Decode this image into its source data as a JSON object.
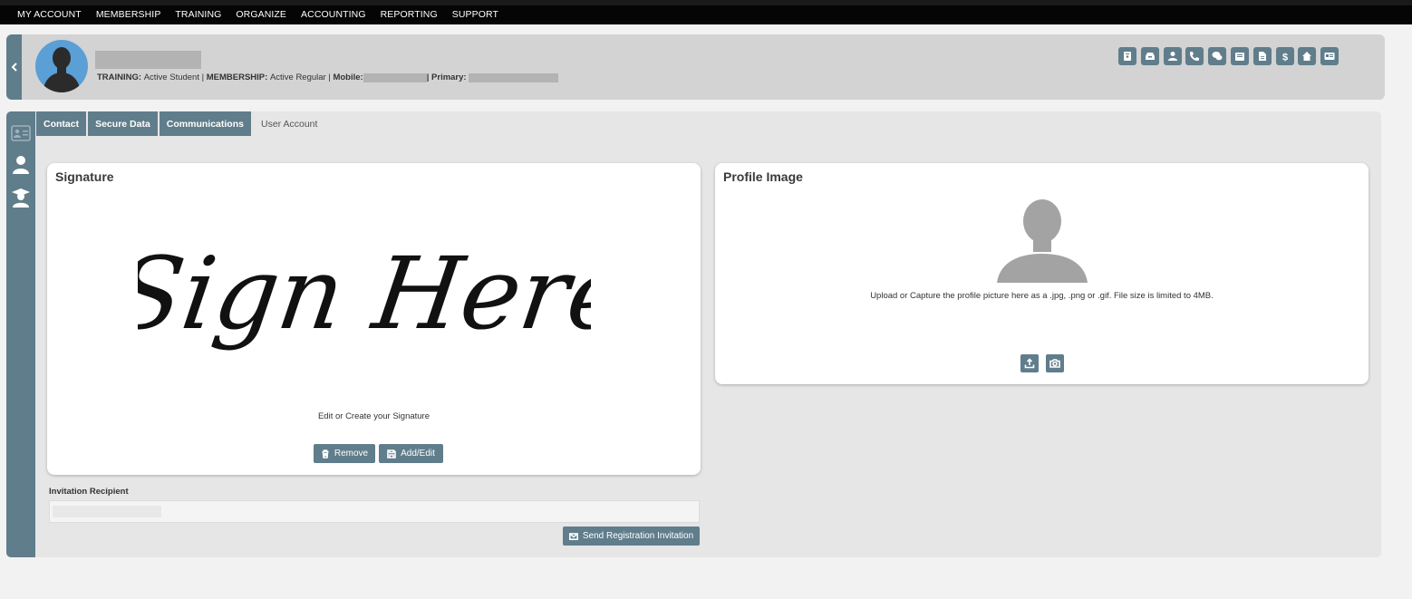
{
  "top_nav": {
    "items": [
      "MY ACCOUNT",
      "MEMBERSHIP",
      "TRAINING",
      "ORGANIZE",
      "ACCOUNTING",
      "REPORTING",
      "SUPPORT"
    ]
  },
  "header": {
    "collapse_icon": "chevron-left-icon",
    "avatar_icon": "person-silhouette-icon",
    "training_label": "TRAINING:",
    "training_value": "Active Student",
    "membership_label": "MEMBERSHIP:",
    "membership_value": "Active Regular",
    "mobile_label": "Mobile:",
    "primary_label": "Primary:",
    "separator": "|",
    "quick_icons": [
      "id-badge-icon",
      "inbox-icon",
      "person-icon",
      "phone-icon",
      "chat-icon",
      "mail-tray-icon",
      "document-icon",
      "dollar-icon",
      "house-icon",
      "id-card-icon"
    ]
  },
  "side_rail": {
    "icons": [
      "contact-card-icon",
      "user-icon",
      "student-icon"
    ]
  },
  "tabs": [
    {
      "label": "Contact",
      "active": true
    },
    {
      "label": "Secure Data",
      "active": true
    },
    {
      "label": "Communications",
      "active": true
    },
    {
      "label": "User Account",
      "active": false
    }
  ],
  "signature": {
    "title": "Signature",
    "image_text": "Sign Here",
    "caption": "Edit or Create your Signature",
    "remove_label": "Remove",
    "add_edit_label": "Add/Edit"
  },
  "profile_image": {
    "title": "Profile Image",
    "caption": "Upload or Capture the profile picture here as a .jpg, .png or .gif. File size is limited to 4MB.",
    "upload_icon": "upload-icon",
    "camera_icon": "camera-icon"
  },
  "invitation": {
    "label": "Invitation Recipient",
    "send_label": "Send Registration Invitation"
  },
  "colors": {
    "accent": "#607d8b",
    "nav_bg": "#050505",
    "header_bg": "#d3d3d3",
    "panel_bg": "#e6e6e6",
    "avatar_bg": "#5a9fd6"
  }
}
